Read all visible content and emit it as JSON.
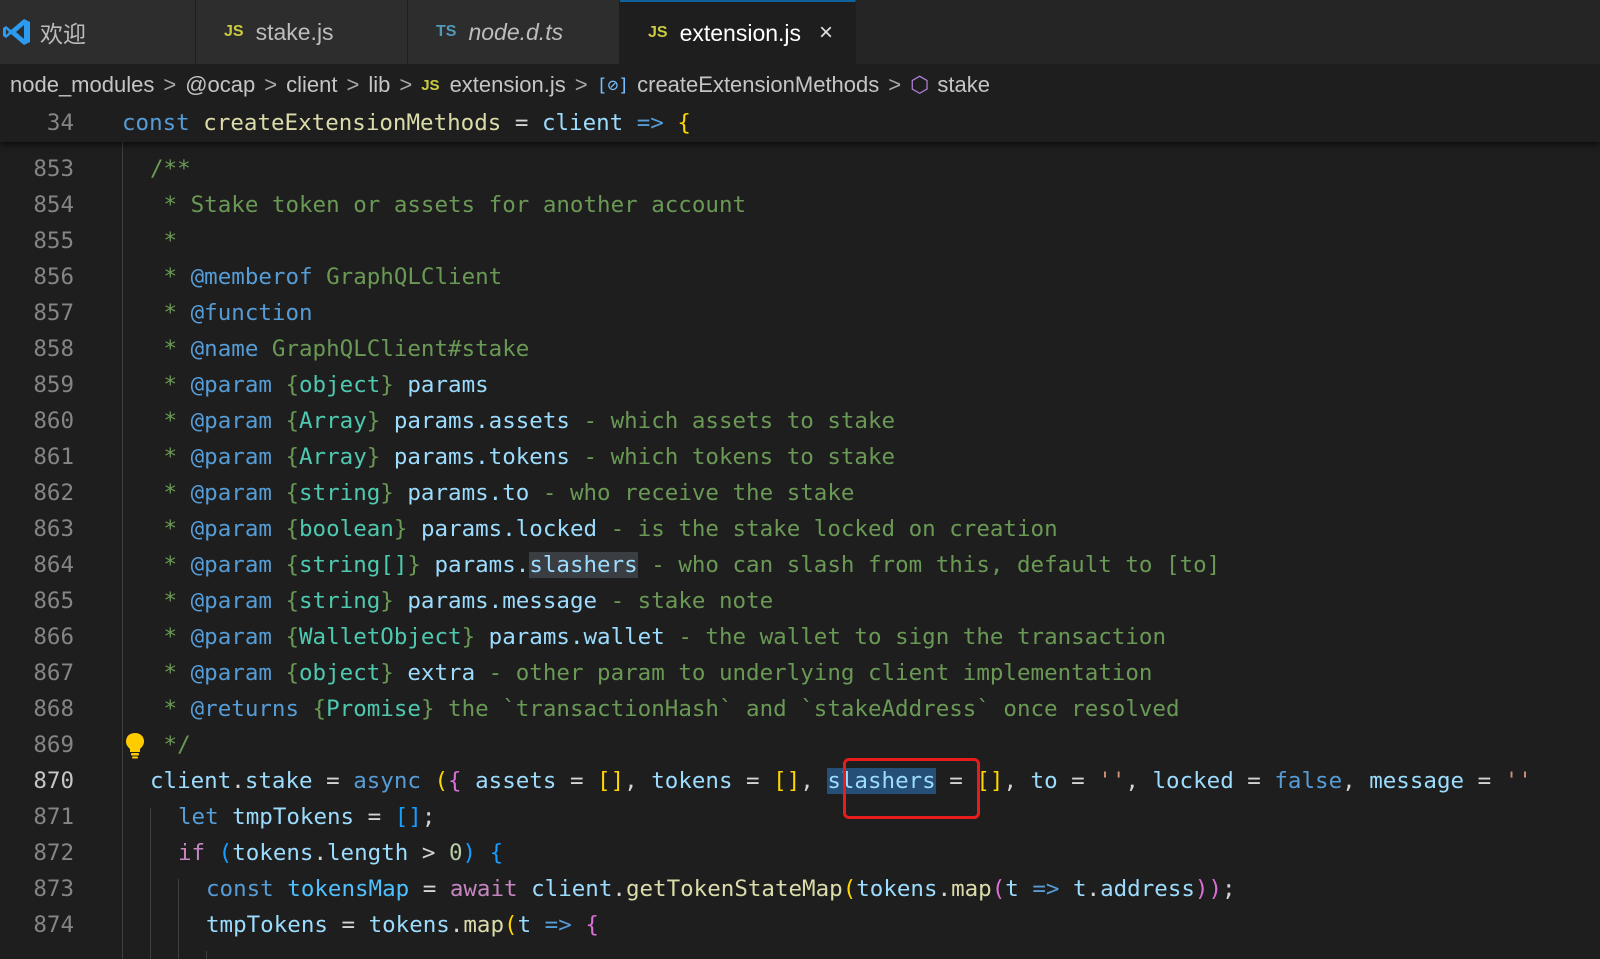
{
  "tabs": [
    {
      "label": "欢迎",
      "type": "welcome"
    },
    {
      "label": "stake.js",
      "badge": "JS"
    },
    {
      "label": "node.d.ts",
      "badge": "TS"
    },
    {
      "label": "extension.js",
      "badge": "JS",
      "close": "×"
    }
  ],
  "breadcrumb": {
    "parts": [
      "node_modules",
      "@ocap",
      "client",
      "lib"
    ],
    "file_badge": "JS",
    "file": "extension.js",
    "var_icon": "[⊘]",
    "symbol": "createExtensionMethods",
    "member": "stake",
    "sep": ">"
  },
  "sticky": {
    "num": "34",
    "t1": "const",
    "t2": "createExtensionMethods",
    "t3": " = ",
    "t4": "client",
    "t5": " => ",
    "t6": "{"
  },
  "lines": {
    "l853": {
      "num": "853",
      "a": "/**"
    },
    "l854": {
      "num": "854",
      "a": " * Stake token or assets for another account"
    },
    "l855": {
      "num": "855",
      "a": " *"
    },
    "l856": {
      "num": "856",
      "a": " * ",
      "b": "@memberof",
      "c": " GraphQLClient"
    },
    "l857": {
      "num": "857",
      "a": " * ",
      "b": "@function"
    },
    "l858": {
      "num": "858",
      "a": " * ",
      "b": "@name",
      "c": " GraphQLClient#stake"
    },
    "l859": {
      "num": "859",
      "a": " * ",
      "b": "@param",
      "c": " {",
      "d": "object",
      "e": "} ",
      "f": "params"
    },
    "l860": {
      "num": "860",
      "a": " * ",
      "b": "@param",
      "c": " {",
      "d": "Array",
      "e": "} ",
      "f": "params.assets",
      "g": " - which assets to stake"
    },
    "l861": {
      "num": "861",
      "a": " * ",
      "b": "@param",
      "c": " {",
      "d": "Array",
      "e": "} ",
      "f": "params.tokens",
      "g": " - which tokens to stake"
    },
    "l862": {
      "num": "862",
      "a": " * ",
      "b": "@param",
      "c": " {",
      "d": "string",
      "e": "} ",
      "f": "params.to",
      "g": " - who receive the stake"
    },
    "l863": {
      "num": "863",
      "a": " * ",
      "b": "@param",
      "c": " {",
      "d": "boolean",
      "e": "} ",
      "f": "params.locked",
      "g": " - is the stake locked on creation"
    },
    "l864": {
      "num": "864",
      "a": " * ",
      "b": "@param",
      "c": " {",
      "d": "string[]",
      "e": "} ",
      "f": "params.",
      "f2": "slashers",
      "g": " - who can slash from this, default to [to]"
    },
    "l865": {
      "num": "865",
      "a": " * ",
      "b": "@param",
      "c": " {",
      "d": "string",
      "e": "} ",
      "f": "params.message",
      "g": " - stake note"
    },
    "l866": {
      "num": "866",
      "a": " * ",
      "b": "@param",
      "c": " {",
      "d": "WalletObject",
      "e": "} ",
      "f": "params.wallet",
      "g": " - the wallet to sign the transaction"
    },
    "l867": {
      "num": "867",
      "a": " * ",
      "b": "@param",
      "c": " {",
      "d": "object",
      "e": "} ",
      "f": "extra",
      "g": " - other param to underlying client implementation"
    },
    "l868": {
      "num": "868",
      "a": " * ",
      "b": "@returns",
      "c": " {",
      "d": "Promise",
      "e": "} ",
      "g": "the `transactionHash` and `stakeAddress` once resolved"
    },
    "l869": {
      "num": "869",
      "a": " */"
    },
    "l870": {
      "num": "870"
    },
    "l871": {
      "num": "871"
    },
    "l872": {
      "num": "872"
    },
    "l873": {
      "num": "873"
    },
    "l874": {
      "num": "874"
    }
  },
  "code870": {
    "t1": "client",
    "t2": ".",
    "t3": "stake",
    "t4": " = ",
    "t5": "async",
    "t6": " ",
    "t7": "(",
    "t8": "{",
    "t9": " assets",
    "t10": " = ",
    "t11": "[]",
    "t12": ", ",
    "t13": "tokens",
    "t14": " = ",
    "t15": "[]",
    "t16": ", ",
    "t17": "slashers",
    "t18": " = ",
    "t19": "[]",
    "t20": ", ",
    "t21": "to",
    "t22": " = ",
    "t23": "''",
    "t24": ", ",
    "t25": "locked",
    "t26": " = ",
    "t27": "false",
    "t28": ", ",
    "t29": "message",
    "t30": " = ",
    "t31": "''"
  },
  "code871": {
    "t1": "let",
    "t2": " tmpTokens",
    "t3": " = ",
    "t4": "[]",
    "t5": ";"
  },
  "code872": {
    "t1": "if",
    "t2": " (",
    "t3": "tokens",
    "t4": ".",
    "t5": "length",
    "t6": " > ",
    "t7": "0",
    "t8": ") ",
    "t9": "{"
  },
  "code873": {
    "t1": "const",
    "t2": " tokensMap",
    "t3": " = ",
    "t4": "await",
    "t5": " client",
    "t6": ".",
    "t7": "getTokenStateMap",
    "t8": "(",
    "t9": "tokens",
    "t10": ".",
    "t11": "map",
    "t12": "(",
    "t13": "t",
    "t14": " => ",
    "t15": "t",
    "t16": ".",
    "t17": "address",
    "t18": "))",
    "t19": ";"
  },
  "code874": {
    "t1": "tmpTokens",
    "t2": " = ",
    "t3": "tokens",
    "t4": ".",
    "t5": "map",
    "t6": "(",
    "t7": "t",
    "t8": " => ",
    "t9": "{"
  },
  "colors": {
    "editor_bg": "#1e1e1e",
    "tab_active_border": "#0e639c",
    "annotation_box": "#e81c1c",
    "selection": "#264f78"
  }
}
